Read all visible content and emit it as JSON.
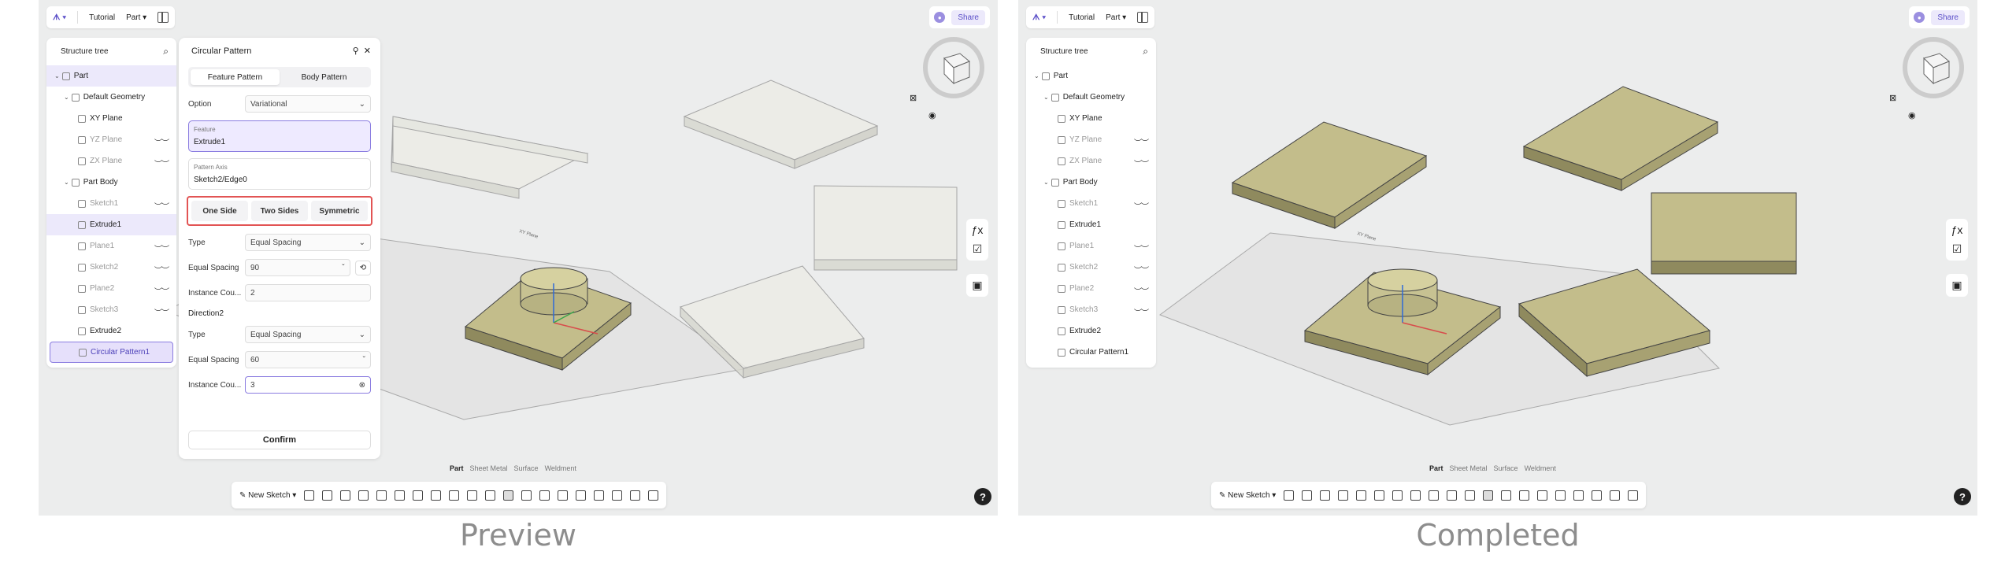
{
  "colors": {
    "accent": "#5b4fc8",
    "highlight_border": "#e25454",
    "selection": "#ece9fb",
    "solid": "#b9b486",
    "ghost": "#e2e2dc"
  },
  "topbar": {
    "tutorial": "Tutorial",
    "part": "Part"
  },
  "share": {
    "label": "Share"
  },
  "tree": {
    "title": "Structure tree",
    "items": [
      {
        "label": "Part"
      },
      {
        "label": "Default Geometry"
      },
      {
        "label": "XY Plane"
      },
      {
        "label": "YZ Plane"
      },
      {
        "label": "ZX Plane"
      },
      {
        "label": "Part Body"
      },
      {
        "label": "Sketch1"
      },
      {
        "label": "Extrude1"
      },
      {
        "label": "Plane1"
      },
      {
        "label": "Sketch2"
      },
      {
        "label": "Plane2"
      },
      {
        "label": "Sketch3"
      },
      {
        "label": "Extrude2"
      },
      {
        "label": "Circular Pattern1"
      }
    ]
  },
  "dialog": {
    "title": "Circular Pattern",
    "tab_feature": "Feature Pattern",
    "tab_body": "Body Pattern",
    "option_label": "Option",
    "option_value": "Variational",
    "feature_label": "Feature",
    "feature_value": "Extrude1",
    "axis_label": "Pattern Axis",
    "axis_value": "Sketch2/Edge0",
    "btn_one": "One Side",
    "btn_two": "Two Sides",
    "btn_sym": "Symmetric",
    "type_label": "Type",
    "type_value": "Equal Spacing",
    "spacing_label": "Equal Spacing",
    "spacing_value": "90",
    "count_label": "Instance Cou...",
    "count_value": "2",
    "dir2_label": "Direction2",
    "type2_value": "Equal Spacing",
    "spacing2_value": "60",
    "count2_value": "3",
    "confirm": "Confirm"
  },
  "modes": [
    "Part",
    "Sheet Metal",
    "Surface",
    "Weldment"
  ],
  "toolbar": {
    "new_sketch": "New Sketch"
  },
  "captions": {
    "left": "Preview",
    "right": "Completed"
  },
  "viewport": {
    "plane_label": "XY Plane"
  }
}
